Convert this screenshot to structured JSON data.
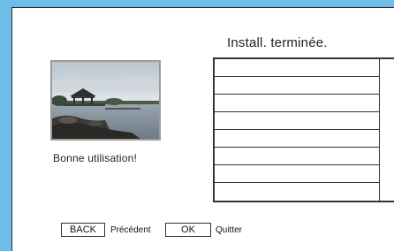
{
  "dialog": {
    "title": "Install. terminée.",
    "caption": "Bonne utilisation!"
  },
  "list": {
    "rows": [
      "",
      "",
      "",
      "",
      "",
      "",
      "",
      ""
    ]
  },
  "footer": {
    "back_button": "BACK",
    "back_label": "Précédent",
    "ok_button": "OK",
    "ok_label": "Quitter"
  },
  "colors": {
    "background": "#6dbde8",
    "panel": "#ffffff",
    "border": "#333333"
  }
}
